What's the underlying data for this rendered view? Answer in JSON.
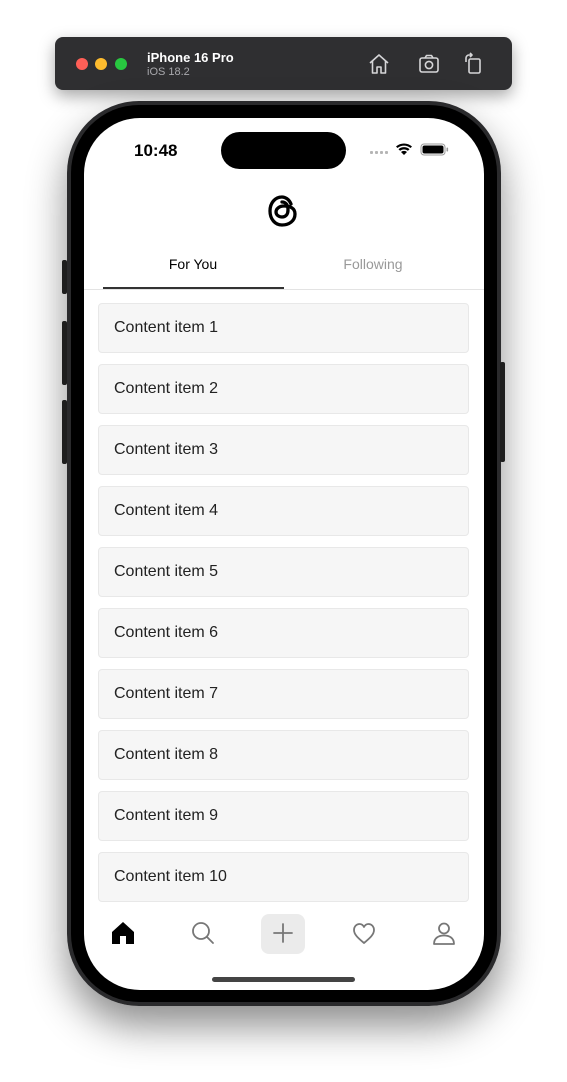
{
  "simulator": {
    "device_name": "iPhone 16 Pro",
    "os_version": "iOS 18.2",
    "buttons": [
      "home-icon",
      "screenshot-icon",
      "rotate-icon"
    ]
  },
  "status_bar": {
    "time": "10:48",
    "icons": [
      "signal-icon",
      "wifi-icon",
      "battery-icon"
    ]
  },
  "header": {
    "logo": "threads-logo"
  },
  "tabs": [
    {
      "label": "For You",
      "active": true
    },
    {
      "label": "Following",
      "active": false
    }
  ],
  "feed": {
    "items": [
      {
        "label": "Content item 1"
      },
      {
        "label": "Content item 2"
      },
      {
        "label": "Content item 3"
      },
      {
        "label": "Content item 4"
      },
      {
        "label": "Content item 5"
      },
      {
        "label": "Content item 6"
      },
      {
        "label": "Content item 7"
      },
      {
        "label": "Content item 8"
      },
      {
        "label": "Content item 9"
      },
      {
        "label": "Content item 10"
      }
    ]
  },
  "tab_bar": {
    "items": [
      "home-icon",
      "search-icon",
      "add-icon",
      "heart-icon",
      "profile-icon"
    ],
    "active": "home-icon"
  },
  "colors": {
    "item_background": "#f6f6f6",
    "active_tab_text": "#000000",
    "inactive_tab_text": "#999999",
    "simulator_bar": "#2f2f31"
  }
}
